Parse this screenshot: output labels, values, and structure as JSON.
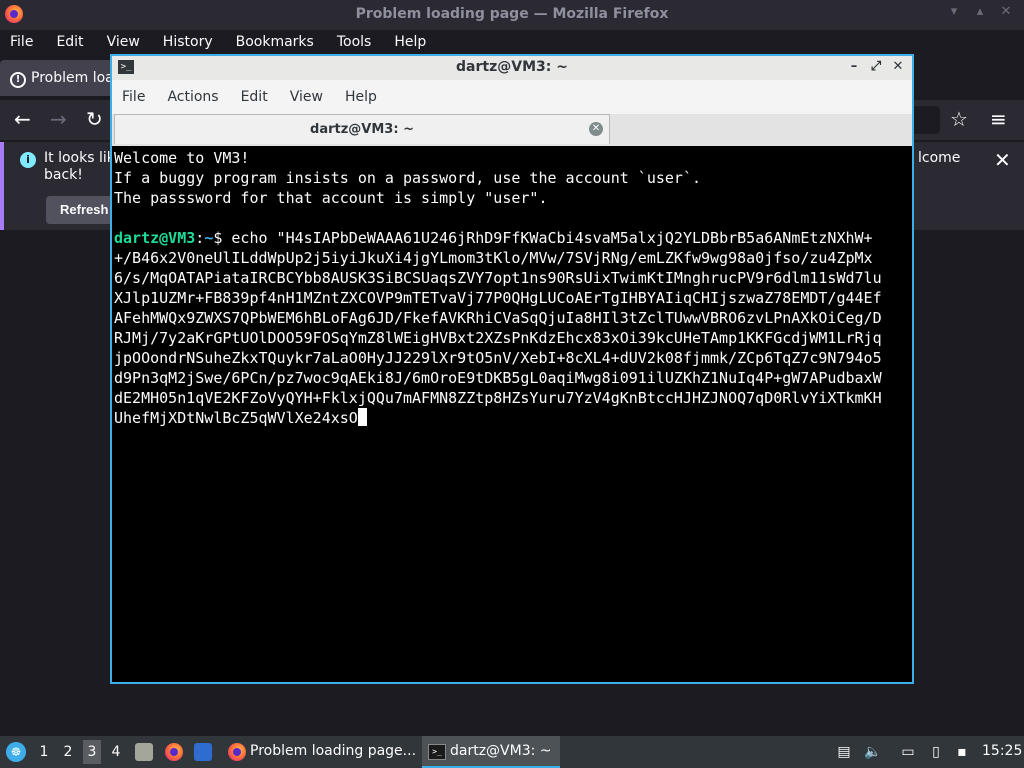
{
  "firefox": {
    "window_title": "Problem loading page — Mozilla Firefox",
    "menu": [
      "File",
      "Edit",
      "View",
      "History",
      "Bookmarks",
      "Tools",
      "Help"
    ],
    "tab_title": "Problem loa",
    "notification": {
      "text_line1": "It looks lik",
      "text_line2": "back!",
      "text_right": "lcome",
      "refresh_label": "Refresh"
    }
  },
  "terminal": {
    "window_title": "dartz@VM3: ~",
    "menu": [
      "File",
      "Actions",
      "Edit",
      "View",
      "Help"
    ],
    "tab_label": "dartz@VM3: ~",
    "output": [
      "Welcome to VM3!",
      "If a buggy program insists on a password, use the account `user`.",
      "The passsword for that account is simply \"user\"."
    ],
    "prompt_user": "dartz@VM3",
    "prompt_sep": ":",
    "prompt_path": "~",
    "prompt_symbol": "$",
    "command": " echo \"H4sIAPbDeWAAA61U246jRhD9FfKWaCbi4svaM5alxjQ2YLDBbrB5a6ANmEtzNXhW++/B46x2V0neUlILddWpUp2j5iyiJkuXi4jgYLmom3tKlo/MVw/7SVjRNg/emLZKfw9wg98a0jfso/zu4ZpMx6/s/MqOATAPiataIRCBCYbb8AUSK3SiBCSUaqsZVY7opt1ns90RsUixTwimKtIMnghrucPV9r6dlm11sWd7luXJlp1UZMr+FB839pf4nH1MZntZXCOVP9mTETvaVj77P0QHgLUCoAErTgIHBYAIiqCHIjszwaZ78EMDT/g44EfAFehMWQx9ZWXS7QPbWEM6hBLoFAg6JD/FkefAVKRhiCVaSqQjuIa8HIl3tZclTUwwVBRO6zvLPnAXkOiCeg/DRJMj/7y2aKrGPtUOlDOO59FOSqYmZ8lWEigHVBxt2XZsPnKdzEhcx83xOi39kcUHeTAmp1KKFGcdjWM1LrRjqjpOOondrNSuheZkxTQuykr7aLaO0HyJJ229lXr9tO5nV/XebI+8cXL4+dUV2k08fjmmk/ZCp6TqZ7c9N794o5d9Pn3qM2jSwe/6PCn/pz7woc9qAEki8J/6mOroE9tDKB5gL0aqiMwg8i091ilUZKhZ1NuIq4P+gW7APudbaxWdE2MH05n1qVE2KFZoVyQYH+FklxjQQu7mAFMN8ZZtp8HZsYuru7YzV4gKnBtccHJHZJNOQ7qD0RlvYiXTkmKHUhefMjXDtNwlBcZ5qWVlXe24xsO",
    "cursor": "█"
  },
  "taskbar": {
    "workspaces": [
      "1",
      "2",
      "3",
      "4"
    ],
    "active_workspace": "3",
    "tasks": [
      {
        "label": "Problem loading page...",
        "icon": "firefox-icon"
      },
      {
        "label": "dartz@VM3: ~",
        "icon": "terminal-icon"
      }
    ],
    "clock": "15:25"
  }
}
